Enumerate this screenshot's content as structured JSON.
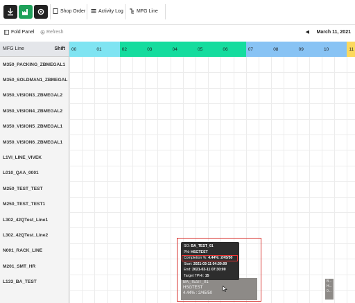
{
  "toolbar": {
    "buttons": [
      {
        "icon": "download-icon",
        "bg": "#222222"
      },
      {
        "icon": "factory-icon",
        "bg": "#1fa15a"
      },
      {
        "icon": "settings-icon",
        "bg": "#222222"
      }
    ],
    "links": [
      "Shop Order",
      "Activity Log",
      "MFG Line"
    ]
  },
  "subbar": {
    "fold_label": "Fold Panel",
    "refresh_label": "Refresh",
    "date": "March 11, 2021"
  },
  "grid": {
    "left_header": "MFG Line",
    "shift_header": "Shift",
    "hours": [
      {
        "label": "00",
        "color": "#7fe4f2"
      },
      {
        "label": "01",
        "color": "#7fe4f2"
      },
      {
        "label": "02",
        "color": "#15dc9e"
      },
      {
        "label": "03",
        "color": "#15dc9e"
      },
      {
        "label": "04",
        "color": "#15dc9e"
      },
      {
        "label": "05",
        "color": "#15dc9e"
      },
      {
        "label": "06",
        "color": "#15dc9e"
      },
      {
        "label": "07",
        "color": "#88c3f4"
      },
      {
        "label": "08",
        "color": "#88c3f4"
      },
      {
        "label": "09",
        "color": "#88c3f4"
      },
      {
        "label": "10",
        "color": "#88c3f4"
      },
      {
        "label": "11",
        "color": "#fcd95d"
      }
    ],
    "lines": [
      "M350_PACKING_ZBMEGAL1",
      "M350_SOLDMAN1_ZBMEGAL",
      "M350_VISION3_ZBMEGAL2",
      "M350_VISION4_ZBMEGAL2",
      "M350_VISION5_ZBMEGAL1",
      "M350_VISION6_ZBMEGAL1",
      "L1VI_LINE_VIVEK",
      "L010_QAA_0001",
      "M250_TEST_TEST",
      "M250_TEST_TEST1",
      "L302_42QTest_Line1",
      "L302_42QTest_Line2",
      "N001_RACK_LINE",
      "M201_SMT_HR",
      "L133_BA_TEST"
    ]
  },
  "task": {
    "line1": "BA_TEST_01",
    "line2": "HSGTEST",
    "line3": "4.44% : 2/45/50"
  },
  "task_small": {
    "line1": "B...",
    "line2": "H...",
    "line3": "0..."
  },
  "tooltip": {
    "so_label": "SO:",
    "so": "BA_TEST_01",
    "pn_label": "PN:",
    "pn": "HSGTEST",
    "comp_label": "Completion %:",
    "comp": "4.44%: 2/45/50",
    "start_label": "Start:",
    "start": "2021-03-11 04:30:00",
    "end_label": "End:",
    "end": "2021-03-11 07:30:00",
    "tph_label": "Target TPHr:",
    "tph": "15"
  }
}
